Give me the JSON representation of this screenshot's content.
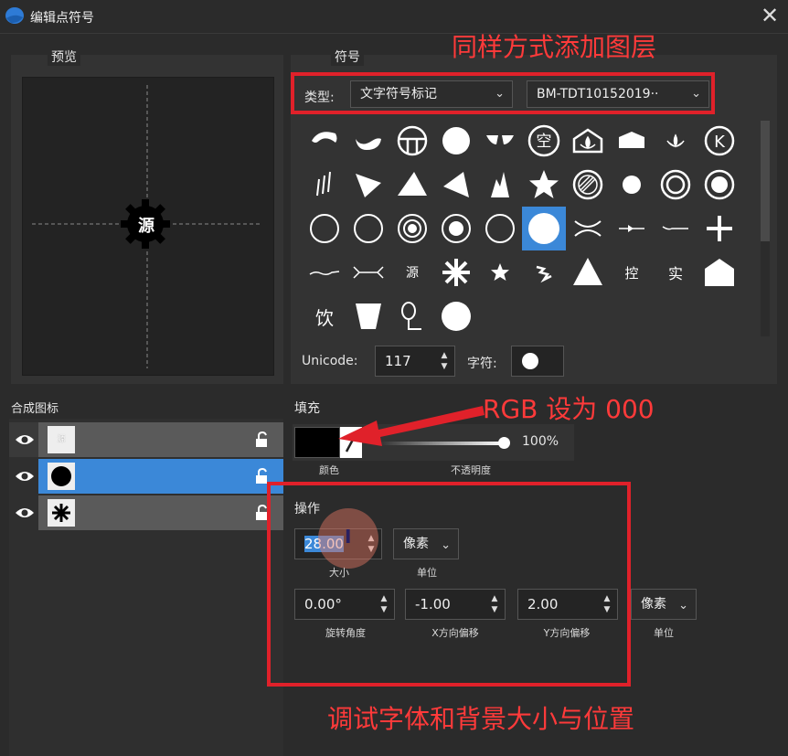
{
  "window": {
    "title": "编辑点符号",
    "close_glyph": "✕"
  },
  "preview": {
    "label": "预览",
    "symbol_char": "源"
  },
  "symbol": {
    "label": "符号",
    "type_label": "类型:",
    "type_value": "文字符号标记",
    "font_value": "BM-TDT10152019··",
    "unicode_label": "Unicode:",
    "unicode_value": "117",
    "char_label": "字符:",
    "grid_chars": {
      "kong": "空",
      "yuan": "源",
      "kong2": "控",
      "shi": "实",
      "yin": "饮",
      "k": "K"
    }
  },
  "layers": {
    "label": "合成图标",
    "rows": [
      {
        "thumb_text": "源",
        "selected": false
      },
      {
        "thumb_text": "",
        "selected": true
      },
      {
        "thumb_text": "",
        "selected": false
      }
    ]
  },
  "fill": {
    "label": "填充",
    "color_label": "颜色",
    "opacity_label": "不透明度",
    "opacity_value": "100%",
    "opacity_level": 1.0,
    "color": "#000000"
  },
  "operation": {
    "label": "操作",
    "size_value": "28.00",
    "size_label": "大小",
    "unit_value": "像素",
    "unit_label": "单位",
    "rotation_value": "0.00°",
    "rotation_label": "旋转角度",
    "x_offset_value": "-1.00",
    "x_offset_label": "X方向偏移",
    "y_offset_value": "2.00",
    "y_offset_label": "Y方向偏移",
    "unit2_value": "像素",
    "unit2_label": "单位"
  },
  "annotations": {
    "top": "同样方式添加图层",
    "rgb": "RGB 设为 000",
    "bottom": "调试字体和背景大小与位置"
  },
  "colors": {
    "selection": "#3b88d8",
    "annotation_red": "#e0212a",
    "accent_layer": "#3b88d8"
  }
}
